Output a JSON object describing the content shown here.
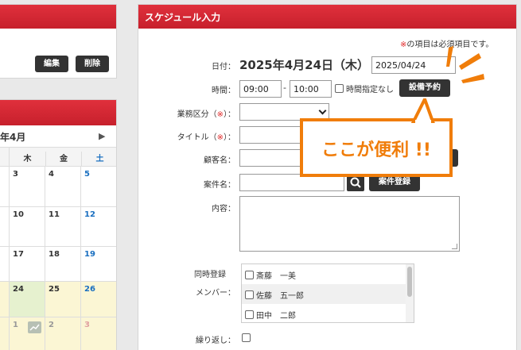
{
  "left_top_panel": {
    "edit_label": "編集",
    "delete_label": "削除"
  },
  "calendar": {
    "month_label": "年4月",
    "next_arrow": "▶",
    "weekdays": [
      "木",
      "金",
      "土"
    ],
    "rows": [
      [
        "3",
        "4",
        "5"
      ],
      [
        "10",
        "11",
        "12"
      ],
      [
        "17",
        "18",
        "19"
      ],
      [
        "24",
        "25",
        "26"
      ],
      [
        "1",
        "2",
        "3"
      ]
    ]
  },
  "schedule_form": {
    "title": "スケジュール入力",
    "required_note_mark": "※",
    "required_note": "の項目は必須項目です。",
    "date_label": "日付：",
    "date_display": "2025年4月24日（木）",
    "date_value": "2025/04/24",
    "time_label": "時間：",
    "start_time": "09:00",
    "time_separator": "-",
    "end_time": "10:00",
    "no_time_label": "時間指定なし",
    "facility_button": "設備予約",
    "category_label": "業務区分（",
    "category_mark": "※",
    "category_close": "）：",
    "title_label": "タイトル（",
    "title_mark": "※",
    "title_close": "）：",
    "customer_label": "顧客名：",
    "project_label": "案件名：",
    "project_register_button": "案件登録",
    "content_label": "内容：",
    "members_label_1": "同時登録",
    "members_label_2": "メンバー：",
    "members": [
      "斎藤　一美",
      "佐藤　五一郎",
      "田中　二郎"
    ],
    "repeat_label": "繰り返し："
  },
  "callout": {
    "text": "ここが便利 !!",
    "accent": "#f07d0a"
  }
}
